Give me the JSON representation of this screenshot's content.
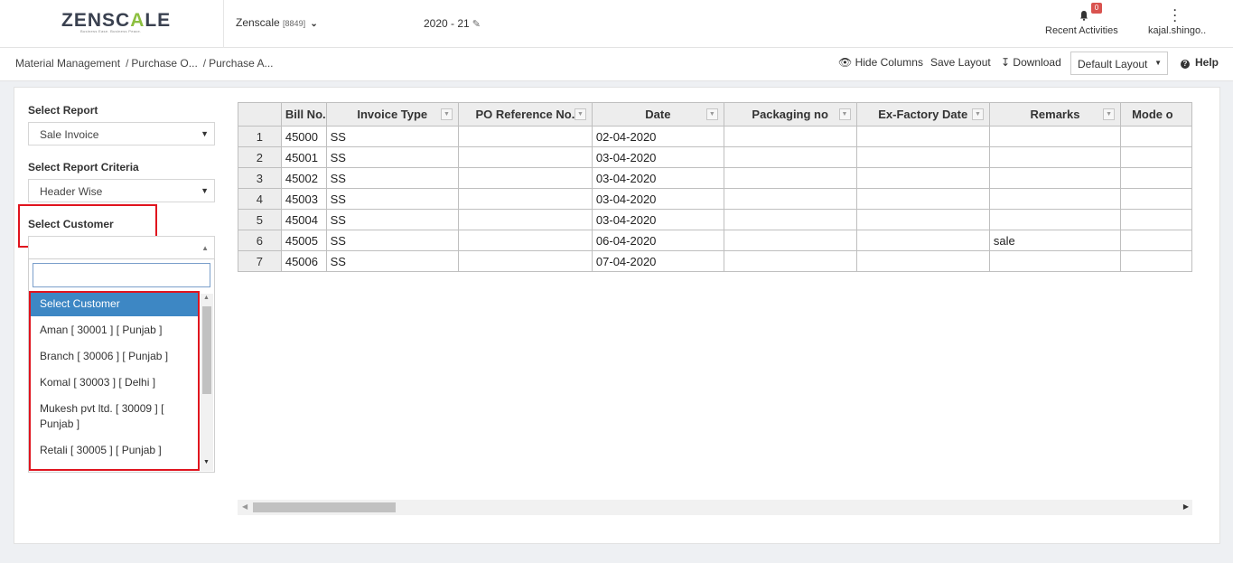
{
  "header": {
    "logo_prefix": "ZENSC",
    "logo_accent": "A",
    "logo_suffix": "LE",
    "logo_tagline": "Business Ease. Business Peace.",
    "company": "Zenscale",
    "company_code": "[8849]",
    "fiscal_year": "2020 - 21",
    "notification_count": "0",
    "activities_label": "Recent Activities",
    "user_name": "kajal.shingo.."
  },
  "breadcrumb": {
    "root": "Material Management",
    "level2": "Purchase O...",
    "level3": "Purchase A..."
  },
  "toolbar": {
    "hide_columns": "Hide Columns",
    "save_layout": "Save Layout",
    "download": "Download",
    "layout_value": "Default Layout",
    "help": "Help"
  },
  "filters": {
    "report_label": "Select Report",
    "report_value": "Sale Invoice",
    "criteria_label": "Select Report Criteria",
    "criteria_value": "Header Wise",
    "customer_label": "Select Customer",
    "customer_search_value": ""
  },
  "customer_options": [
    "Select Customer",
    "Aman [ 30001 ] [ Punjab ]",
    "Branch [ 30006 ] [ Punjab ]",
    "Komal [ 30003 ] [ Delhi ]",
    "Mukesh pvt ltd. [ 30009 ] [ Punjab ]",
    "Retali [ 30005 ] [ Punjab ]"
  ],
  "grid": {
    "columns": [
      "Bill No.",
      "Invoice Type",
      "PO Reference No.",
      "Date",
      "Packaging no",
      "Ex-Factory Date",
      "Remarks",
      "Mode o"
    ],
    "rows": [
      [
        "1",
        "45000",
        "SS",
        "",
        "02-04-2020",
        "",
        "",
        "",
        ""
      ],
      [
        "2",
        "45001",
        "SS",
        "",
        "03-04-2020",
        "",
        "",
        "",
        ""
      ],
      [
        "3",
        "45002",
        "SS",
        "",
        "03-04-2020",
        "",
        "",
        "",
        ""
      ],
      [
        "4",
        "45003",
        "SS",
        "",
        "03-04-2020",
        "",
        "",
        "",
        ""
      ],
      [
        "5",
        "45004",
        "SS",
        "",
        "03-04-2020",
        "",
        "",
        "",
        ""
      ],
      [
        "6",
        "45005",
        "SS",
        "",
        "06-04-2020",
        "",
        "",
        "sale",
        ""
      ],
      [
        "7",
        "45006",
        "SS",
        "",
        "07-04-2020",
        "",
        "",
        "",
        ""
      ]
    ]
  },
  "colors": {
    "accent": "#8cbf3f",
    "highlight": "#e0141e",
    "selected": "#3d87c4"
  }
}
